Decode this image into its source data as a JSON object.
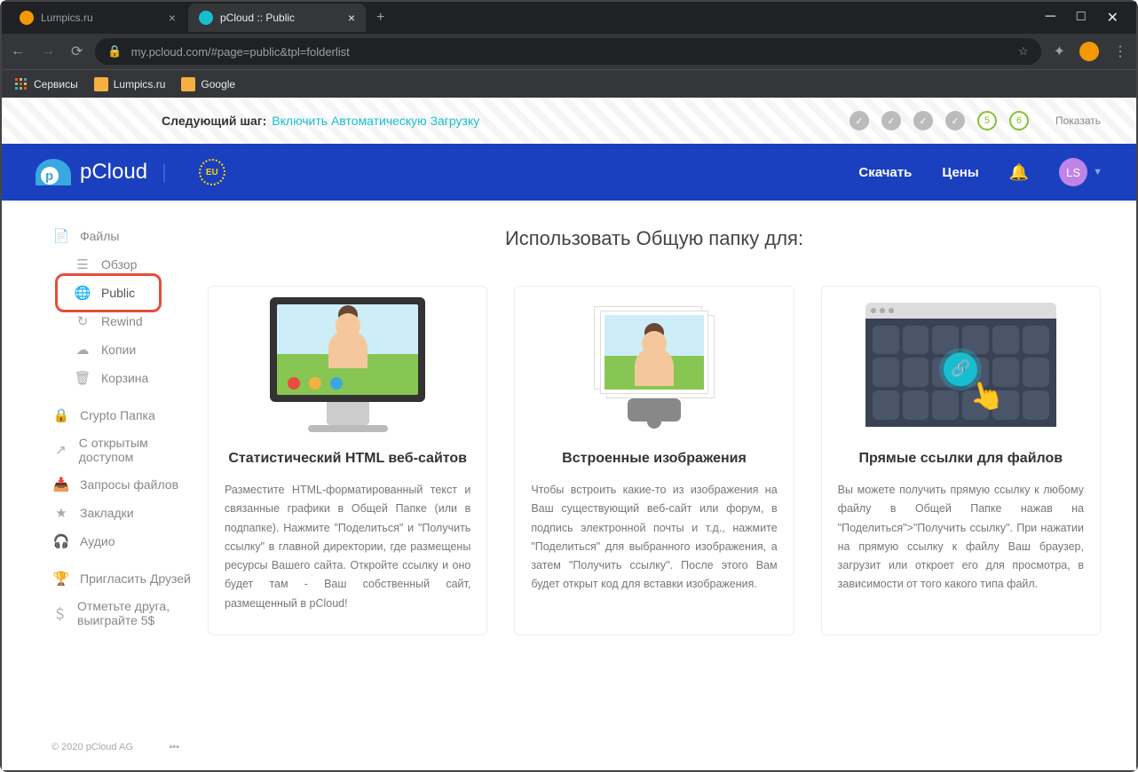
{
  "browser": {
    "tabs": [
      {
        "title": "Lumpics.ru",
        "favicon": "#f29900",
        "active": false
      },
      {
        "title": "pCloud :: Public",
        "favicon": "#17bed0",
        "active": true
      }
    ],
    "url": "my.pcloud.com/#page=public&tpl=folderlist",
    "bookmarks": [
      {
        "label": "Сервисы"
      },
      {
        "label": "Lumpics.ru"
      },
      {
        "label": "Google"
      }
    ]
  },
  "banner": {
    "prefix": "Следующий шаг:",
    "action": "Включить Автоматическую Загрузку",
    "steps_pending": [
      "5",
      "6"
    ],
    "show": "Показать"
  },
  "header": {
    "brand": "pCloud",
    "eu": "EU",
    "download": "Скачать",
    "pricing": "Цены",
    "avatar": "LS"
  },
  "sidebar": {
    "files": "Файлы",
    "overview": "Обзор",
    "public": "Public",
    "rewind": "Rewind",
    "backups": "Копии",
    "trash": "Корзина",
    "crypto": "Crypto Папка",
    "shared": "С открытым доступом",
    "requests": "Запросы файлов",
    "bookmarks": "Закладки",
    "audio": "Аудио",
    "invite": "Пригласить Друзей",
    "refer": "Отметьте друга, выиграйте 5$",
    "copyright": "© 2020 pCloud AG"
  },
  "content": {
    "title": "Использовать Общую папку для:",
    "cards": [
      {
        "title": "Статистический HTML веб-сайтов",
        "text": "Разместите HTML-форматированный текст и связанные графики в Общей Папке (или в подпапке). Нажмите \"Поделиться\" и \"Получить ссылку\" в главной директории, где размещены ресурсы Вашего сайта. Откройте ссылку и оно будет там - Ваш собственный сайт, размещенный в pCloud!"
      },
      {
        "title": "Встроенные изображения",
        "text": "Чтобы встроить какие-то из изображения на Ваш существующий веб-сайт или форум, в подпись электронной почты и т.д., нажмите \"Поделиться\" для выбранного изображения, а затем \"Получить ссылку\". После этого Вам будет открыт код для вставки изображения."
      },
      {
        "title": "Прямые ссылки для файлов",
        "text": "Вы можете получить прямую ссылку к любому файлу в Общей Папке нажав на \"Поделиться\">\"Получить ссылку\". При нажатии на прямую ссылку к файлу Ваш браузер, загрузит или откроет его для просмотра, в зависимости от того какого типа файл."
      }
    ]
  }
}
